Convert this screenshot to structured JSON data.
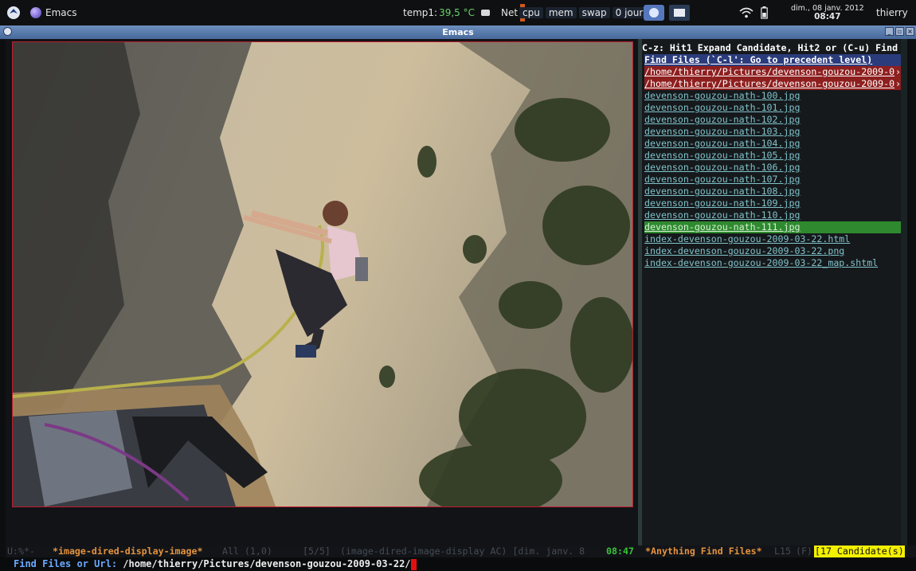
{
  "panel": {
    "app_title": "Emacs",
    "temp_label": "temp1:",
    "temp_value": "39,5 °C",
    "net_label": "Net",
    "cpu_label": "cpu",
    "mem_label": "mem",
    "swap_label": "swap",
    "uptime": "0 jours",
    "date": "dim., 08 janv. 2012",
    "time": "08:47",
    "user": "thierry"
  },
  "window": {
    "title": "Emacs"
  },
  "helm": {
    "header": "C-z: Hit1 Expand Candidate, Hit2 or (C-u) Find",
    "source": "Find Files (`C-l': Go to precedent level)",
    "candidates": [
      "/home/thierry/Pictures/devenson-gouzou-2009-0",
      "/home/thierry/Pictures/devenson-gouzou-2009-0",
      "devenson-gouzou-nath-100.jpg",
      "devenson-gouzou-nath-101.jpg",
      "devenson-gouzou-nath-102.jpg",
      "devenson-gouzou-nath-103.jpg",
      "devenson-gouzou-nath-104.jpg",
      "devenson-gouzou-nath-105.jpg",
      "devenson-gouzou-nath-106.jpg",
      "devenson-gouzou-nath-107.jpg",
      "devenson-gouzou-nath-108.jpg",
      "devenson-gouzou-nath-109.jpg",
      "devenson-gouzou-nath-110.jpg",
      "devenson-gouzou-nath-111.jpg",
      "index-devenson-gouzou-2009-03-22.html",
      "index-devenson-gouzou-2009-03-22.png",
      "index-devenson-gouzou-2009-03-22_map.shtml"
    ],
    "selected_index": 13
  },
  "modeline": {
    "left_status": "U:%*-",
    "left_buffer": "*image-dired-display-image*",
    "left_pos": "All (1,0)",
    "left_count": "[5/5]",
    "left_mode": "(image-dired-image-display AC) [dim. janv.  8",
    "left_time": "08:47",
    "right_buffer": "*Anything Find Files*",
    "right_pos": "L15",
    "right_mode": "(F)",
    "right_candidates": "[17 Candidate(s)"
  },
  "minibuffer": {
    "prompt": "Find Files or Url: ",
    "value": "/home/thierry/Pictures/devenson-gouzou-2009-03-22/"
  },
  "colors": {
    "source_bg": "#2b3c7c",
    "dir_bg": "#8e1f1f",
    "selected_bg": "#2f8a2f",
    "file_fg": "#7fc2c9",
    "buffer_name": "#e4933e",
    "frame_border": "#c01a2c"
  }
}
